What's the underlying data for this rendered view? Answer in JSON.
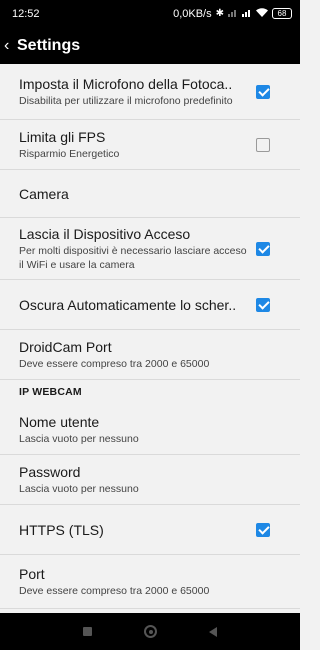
{
  "status_bar": {
    "time": "12:52",
    "net_speed": "0,0KB/s",
    "battery": "68",
    "icons": [
      "bluetooth-icon",
      "signal-icon",
      "signal-icon-2",
      "wifi-icon",
      "battery-icon"
    ]
  },
  "app_bar": {
    "back_icon": "back-chevron-icon",
    "title": "Settings"
  },
  "preferences": [
    {
      "title": "Imposta il Microfono della Fotoca..",
      "summary": "Disabilita per utilizzare il microfono predefinito",
      "checked": true
    },
    {
      "title": "Limita gli FPS",
      "summary": "Risparmio Energetico",
      "checked": false
    },
    {
      "title": "Camera",
      "summary": "",
      "checked": null
    },
    {
      "title": "Lascia il Dispositivo Acceso",
      "summary": "Per molti dispositivi è necessario lasciare acceso il WiFi e usare la camera",
      "checked": true
    },
    {
      "title": "Oscura Automaticamente lo scher..",
      "summary": "",
      "checked": true
    },
    {
      "title": "DroidCam Port",
      "summary": "Deve essere compreso tra 2000 e 65000",
      "checked": null
    }
  ],
  "category": {
    "label": "IP WEBCAM"
  },
  "webcam_preferences": [
    {
      "title": "Nome utente",
      "summary": "Lascia vuoto per nessuno",
      "checked": null
    },
    {
      "title": "Password",
      "summary": "Lascia vuoto per nessuno",
      "checked": null
    },
    {
      "title": "HTTPS (TLS)",
      "summary": "",
      "checked": true
    },
    {
      "title": "Port",
      "summary": "Deve essere compreso tra 2000 e 65000",
      "checked": null
    }
  ],
  "nav_bar": {
    "icons": [
      "recents-square-icon",
      "home-circle-icon",
      "back-triangle-icon"
    ]
  },
  "colors": {
    "checkbox_accent": "#1e88e5",
    "background": "#f2f2f2",
    "bars": "#000000"
  }
}
